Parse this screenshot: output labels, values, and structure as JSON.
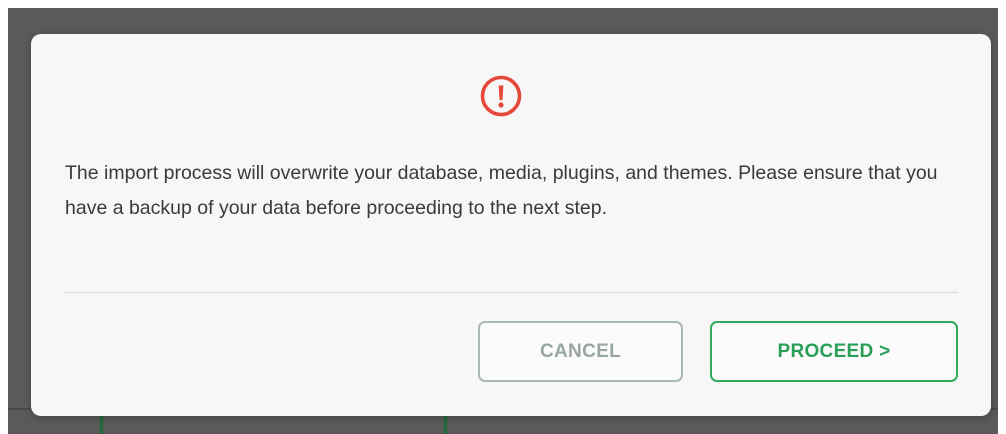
{
  "dialog": {
    "icon": "exclamation-circle-icon",
    "message": "The import process will overwrite your database, media, plugins, and themes. Please ensure that you have a backup of your data before proceeding to the next step.",
    "cancel_label": "CANCEL",
    "proceed_label": "PROCEED >"
  },
  "colors": {
    "icon_red": "#e5493a",
    "proceed_green": "#2faa5f",
    "cancel_gray": "#a9b8b7",
    "backdrop": "#5a5a5a",
    "modal_bg": "#f7f7f7"
  }
}
